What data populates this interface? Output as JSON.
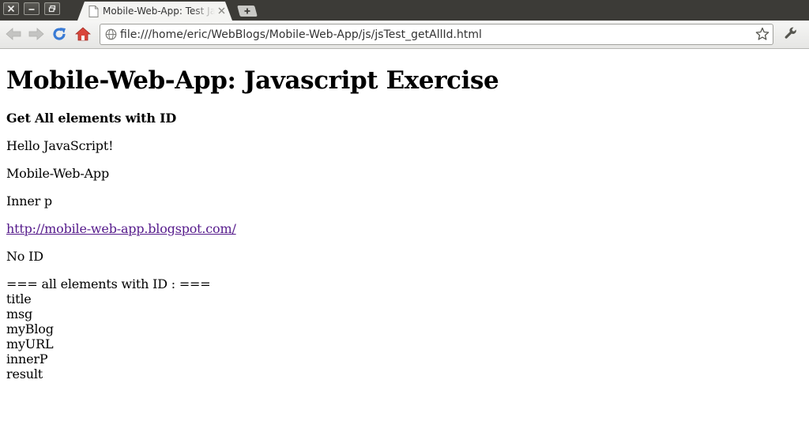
{
  "browser": {
    "tab_title": "Mobile-Web-App: Test Javascript getAllId",
    "url": "file:///home/eric/WebBlogs/Mobile-Web-App/js/jsTest_getAllId.html"
  },
  "page": {
    "heading": "Mobile-Web-App: Javascript Exercise",
    "subheading": "Get All elements with ID",
    "paragraphs": {
      "msg": "Hello JavaScript!",
      "blog": "Mobile-Web-App",
      "inner": "Inner p",
      "url": "http://mobile-web-app.blogspot.com/",
      "noid": "No ID"
    },
    "result": {
      "header": "=== all elements with ID : ===",
      "ids": [
        "title",
        "msg",
        "myBlog",
        "myURL",
        "innerP",
        "result"
      ]
    }
  },
  "colors": {
    "link_visited": "#551a8b",
    "titlebar": "#3c3b37"
  }
}
